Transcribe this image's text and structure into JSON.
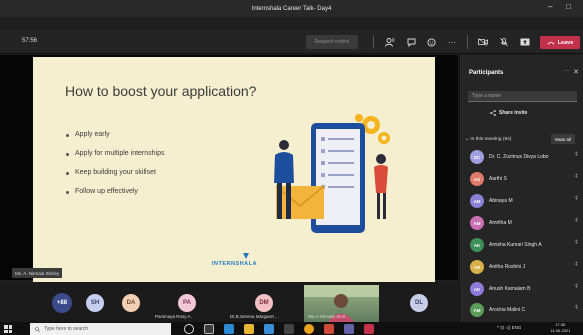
{
  "window": {
    "title": "Internshala Career Talk- Day4",
    "minimize": "–",
    "maximize": "□"
  },
  "toolbar": {
    "timer": "57:56",
    "request_control": "Request control",
    "leave_label": "Leave",
    "leave_color": "#c4314b",
    "icons": [
      "participants-icon",
      "chat-icon",
      "reactions-icon",
      "more-icon",
      "mic-icon",
      "camera-icon",
      "share-icon"
    ]
  },
  "slide": {
    "title": "How to boost your application?",
    "bullets": [
      "Apply early",
      "Apply for multiple internships",
      "Keep building your skillset",
      "Follow up effectively"
    ],
    "brand": "INTERNSHALA",
    "brand_color": "#1f7ac2"
  },
  "presenter_tag": "Ms. A. Nirmala Shirley",
  "gallery": {
    "overflow": "+88",
    "tiles": [
      {
        "initials": "SH",
        "color": "#c7cff0",
        "name": ""
      },
      {
        "initials": "DA",
        "color": "#f1d0b6",
        "name": ""
      },
      {
        "initials": "PA",
        "color": "#f2c7d6",
        "name": "Panimaya Rosy A."
      },
      {
        "initials": "DM",
        "color": "#f2c0c5",
        "name": "Dr.B.Serena Margaret ..."
      },
      {
        "initials": "DL",
        "color": "#c8cde8",
        "name": ""
      }
    ],
    "camera_name": "Ms.A.Nirmala Shirl..."
  },
  "participants": {
    "title": "Participants",
    "search_placeholder": "Type a name",
    "share_invite": "Share invite",
    "section_label": "In this meeting (94)",
    "mute_all": "Mute all",
    "people": [
      {
        "initials": "DC",
        "name": "Dr. C. Zozimus Divya Lobo",
        "color": "#9e9ee0"
      },
      {
        "initials": "AS",
        "name": "Aarthi S",
        "color": "#e07a6a"
      },
      {
        "initials": "AM",
        "name": "Abinaya M",
        "color": "#8a80d6"
      },
      {
        "initials": "AM",
        "name": "Amritha M",
        "color": "#c970b4"
      },
      {
        "initials": "AK",
        "name": "Amisha Kumari Singh A",
        "color": "#3d8f5a"
      },
      {
        "initials": "AR",
        "name": "Anitha Roshini J",
        "color": "#d9b14a"
      },
      {
        "initials": "AK",
        "name": "Anush Kamalam B",
        "color": "#8e7ad8"
      },
      {
        "initials": "AM",
        "name": "Arockia Malini C",
        "color": "#5a9c5a"
      }
    ]
  },
  "taskbar": {
    "search_placeholder": "Type here to search",
    "tray_text": "^ ⊡ ◁) ENG",
    "time": "17:36",
    "date": "14-06-2021"
  }
}
